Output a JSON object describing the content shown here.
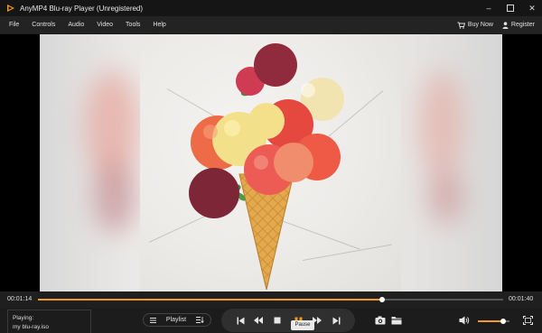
{
  "window": {
    "title": "AnyMP4 Blu-ray Player (Unregistered)",
    "accent": "#f29b1d"
  },
  "menu": {
    "items": [
      "File",
      "Controls",
      "Audio",
      "Video",
      "Tools",
      "Help"
    ],
    "buy_now": "Buy Now",
    "register": "Register"
  },
  "player": {
    "elapsed": "00:01:14",
    "total": "00:01:40",
    "progress": 0.74,
    "volume": 0.8,
    "now_playing_label": "Playing:",
    "now_playing_file": "my blu-ray.iso",
    "playlist_label": "Playlist",
    "tooltip": "Pause"
  },
  "icons": [
    "logo-icon",
    "minimize-icon",
    "maximize-icon",
    "close-icon",
    "cart-icon",
    "user-key-icon",
    "playlist-menu-icon",
    "sort-icon",
    "skip-previous-icon",
    "rewind-icon",
    "stop-icon",
    "pause-icon",
    "fast-forward-icon",
    "skip-next-icon",
    "snapshot-icon",
    "folder-icon",
    "volume-icon",
    "fullscreen-icon"
  ]
}
